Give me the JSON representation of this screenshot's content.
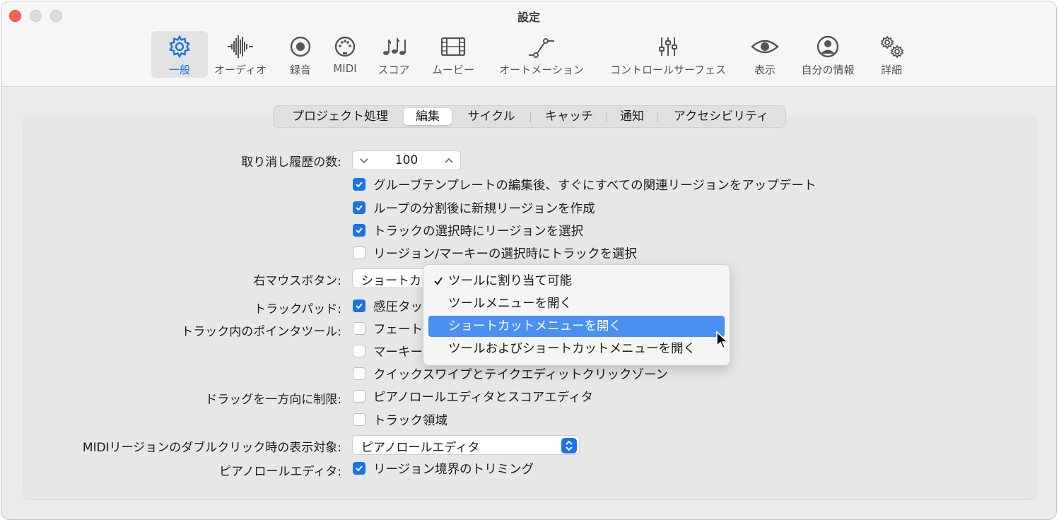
{
  "window": {
    "title": "設定"
  },
  "toolbar": {
    "items": [
      {
        "label": "一般",
        "icon": "gear-icon",
        "active": true
      },
      {
        "label": "オーディオ",
        "icon": "waveform-icon"
      },
      {
        "label": "録音",
        "icon": "record-icon"
      },
      {
        "label": "MIDI",
        "icon": "midi-port-icon"
      },
      {
        "label": "スコア",
        "icon": "music-notes-icon"
      },
      {
        "label": "ムービー",
        "icon": "film-icon"
      },
      {
        "label": "オートメーション",
        "icon": "automation-curve-icon"
      },
      {
        "label": "コントロールサーフェス",
        "icon": "sliders-icon"
      },
      {
        "label": "表示",
        "icon": "eye-icon"
      },
      {
        "label": "自分の情報",
        "icon": "person-circle-icon"
      },
      {
        "label": "詳細",
        "icon": "gears-icon"
      }
    ]
  },
  "tabs": [
    {
      "label": "プロジェクト処理"
    },
    {
      "label": "編集",
      "selected": true
    },
    {
      "label": "サイクル"
    },
    {
      "label": "キャッチ"
    },
    {
      "label": "通知"
    },
    {
      "label": "アクセシビリティ"
    }
  ],
  "settings": {
    "undo_label": "取り消し履歴の数:",
    "undo_value": "100",
    "checks": [
      {
        "label": "グルーブテンプレートの編集後、すぐにすべての関連リージョンをアップデート",
        "checked": true
      },
      {
        "label": "ループの分割後に新規リージョンを作成",
        "checked": true
      },
      {
        "label": "トラックの選択時にリージョンを選択",
        "checked": true
      },
      {
        "label": "リージョン/マーキーの選択時にトラックを選択",
        "checked": false
      }
    ],
    "right_mouse_label": "右マウスボタン:",
    "right_mouse_value": "ショートカ",
    "trackpad_label": "トラックパッド:",
    "trackpad_option": {
      "label": "感圧タッ",
      "checked": true
    },
    "pointer_tool_label": "トラック内のポインタツール:",
    "pointer_options": [
      {
        "label": "フェート",
        "checked": false
      },
      {
        "label": "マーキー",
        "checked": false
      },
      {
        "label": "クイックスワイプとテイクエディットクリックゾーン",
        "checked": false
      }
    ],
    "drag_label": "ドラッグを一方向に制限:",
    "drag_options": [
      {
        "label": "ピアノロールエディタとスコアエディタ",
        "checked": false
      },
      {
        "label": "トラック領域",
        "checked": false
      }
    ],
    "midi_dblclick_label": "MIDIリージョンのダブルクリック時の表示対象:",
    "midi_dblclick_value": "ピアノロールエディタ",
    "piano_roll_label": "ピアノロールエディタ:",
    "piano_roll_option": {
      "label": "リージョン境界のトリミング",
      "checked": true
    }
  },
  "menu": {
    "items": [
      {
        "label": "ツールに割り当て可能",
        "checked": true
      },
      {
        "label": "ツールメニューを開く"
      },
      {
        "label": "ショートカットメニューを開く",
        "highlighted": true
      },
      {
        "label": "ツールおよびショートカットメニューを開く"
      }
    ]
  },
  "colors": {
    "accent": "#1a73e8",
    "highlight": "#4a90f0",
    "close": "#ff5f57"
  }
}
